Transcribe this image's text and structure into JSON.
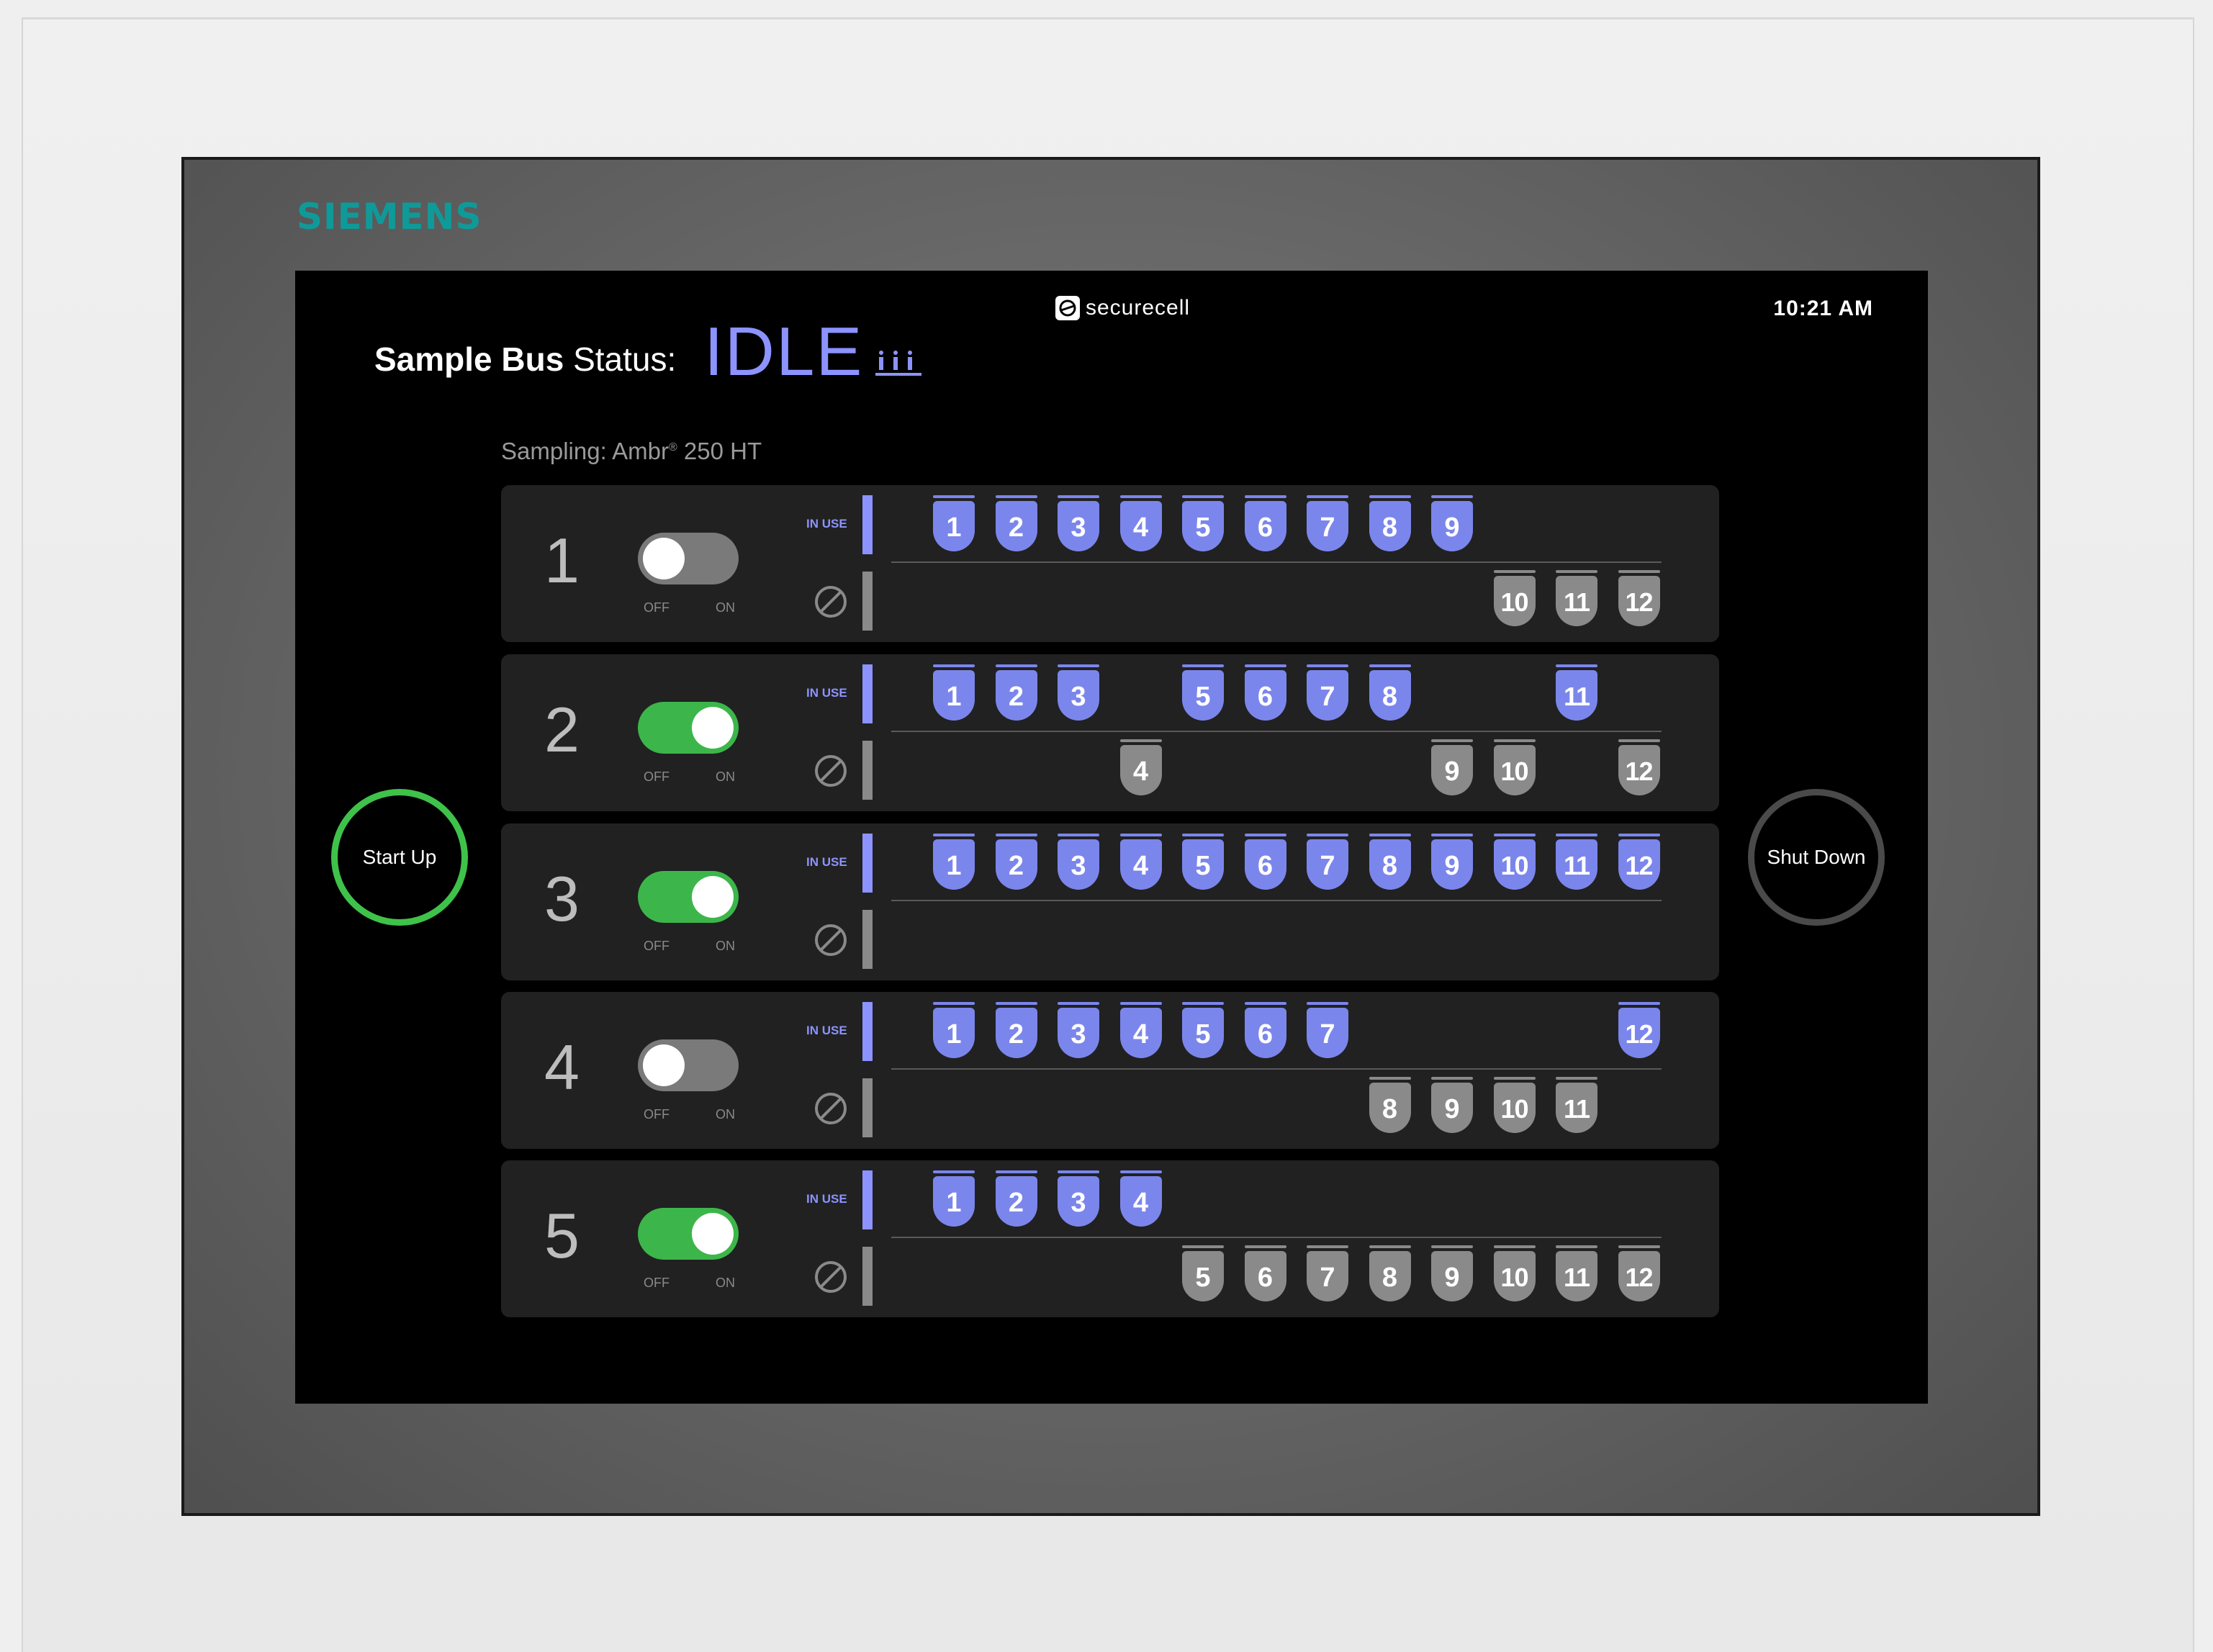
{
  "brand": "SIEMENS",
  "header": {
    "status_label_bold": "Sample Bus",
    "status_label": " Status:",
    "status_value": "IDLE",
    "logo_text": "securecell",
    "clock": "10:21 AM"
  },
  "sampling": {
    "prefix": "Sampling: Ambr",
    "reg": "®",
    "suffix": " 250 HT"
  },
  "buttons": {
    "start": "Start Up",
    "shutdown": "Shut Down"
  },
  "labels": {
    "in_use": "IN USE",
    "off": "OFF",
    "on": "ON"
  },
  "colors": {
    "accent": "#8c93ff",
    "tube_active": "#7b86ec",
    "tube_blocked": "#8a8a8a",
    "toggle_on": "#3cb64a",
    "start_ring": "#3fc24a"
  },
  "rows": [
    {
      "num": "1",
      "enabled": false,
      "in_use": [
        1,
        2,
        3,
        4,
        5,
        6,
        7,
        8,
        9
      ],
      "blocked": [
        10,
        11,
        12
      ]
    },
    {
      "num": "2",
      "enabled": true,
      "in_use": [
        1,
        2,
        3,
        5,
        6,
        7,
        8,
        11
      ],
      "blocked": [
        4,
        9,
        10,
        12
      ]
    },
    {
      "num": "3",
      "enabled": true,
      "in_use": [
        1,
        2,
        3,
        4,
        5,
        6,
        7,
        8,
        9,
        10,
        11,
        12
      ],
      "blocked": []
    },
    {
      "num": "4",
      "enabled": false,
      "in_use": [
        1,
        2,
        3,
        4,
        5,
        6,
        7,
        12
      ],
      "blocked": [
        8,
        9,
        10,
        11
      ]
    },
    {
      "num": "5",
      "enabled": true,
      "in_use": [
        1,
        2,
        3,
        4
      ],
      "blocked": [
        5,
        6,
        7,
        8,
        9,
        10,
        11,
        12
      ]
    }
  ]
}
